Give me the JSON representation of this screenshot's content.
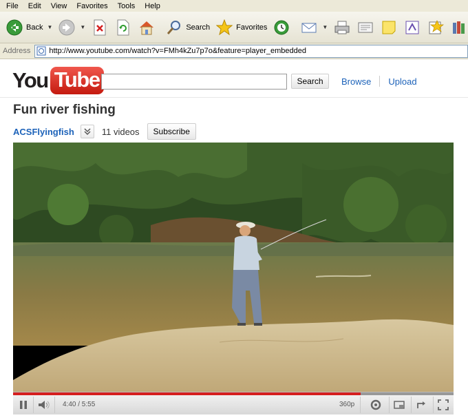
{
  "browser": {
    "menu": [
      "File",
      "Edit",
      "View",
      "Favorites",
      "Tools",
      "Help"
    ],
    "toolbar": {
      "back_label": "Back",
      "search_label": "Search",
      "favorites_label": "Favorites"
    },
    "address": {
      "label": "Address",
      "url": "http://www.youtube.com/watch?v=FMh4kZu7p7o&feature=player_embedded"
    }
  },
  "youtube": {
    "logo_you": "You",
    "logo_tube": "Tube",
    "search_value": "",
    "search_button": "Search",
    "nav": {
      "browse": "Browse",
      "upload": "Upload"
    },
    "video": {
      "title": "Fun river fishing",
      "channel": "ACSFlyingfish",
      "video_count": "11 videos",
      "subscribe": "Subscribe"
    },
    "player": {
      "time": "4:40 / 5:55",
      "quality": "360p",
      "progress": 0.789
    }
  },
  "colors": {
    "link": "#1c62b9",
    "progress": "#d51f1f",
    "logo_red": "#e62117"
  }
}
